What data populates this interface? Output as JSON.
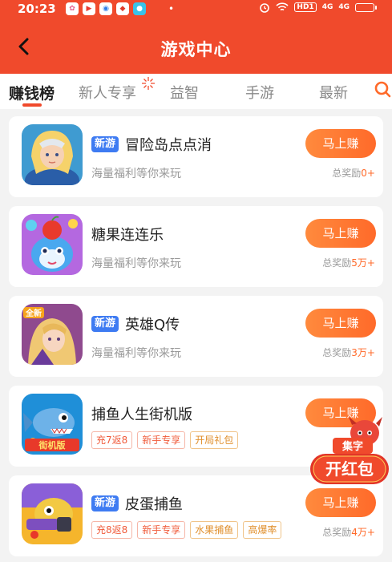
{
  "status_bar": {
    "time": "20:23",
    "hd_label": "HD1",
    "signal_labels": [
      "4G",
      "4G"
    ],
    "app_icons": [
      "gallery-app-icon",
      "video-app-icon",
      "browser-app-icon",
      "game-app-icon",
      "bag-app-icon"
    ],
    "app_glyphs": [
      "✿",
      "▶",
      "◉",
      "◆",
      "●"
    ],
    "bullet": "•"
  },
  "header": {
    "title": "游戏中心",
    "back_icon": "chevron-left-icon"
  },
  "tabs": [
    {
      "label": "赚钱榜",
      "active": true
    },
    {
      "label": "新人专享",
      "active": false
    },
    {
      "label": "益智",
      "active": false
    },
    {
      "label": "手游",
      "active": false
    },
    {
      "label": "最新",
      "active": false
    }
  ],
  "colors": {
    "brand": "#f04a2c",
    "button": "#ff6a2a",
    "new_tag": "#3e7bf2"
  },
  "games": [
    {
      "new_tag": "新游",
      "name": "冒险岛点点消",
      "desc": "海量福利等你来玩",
      "button": "马上赚",
      "reward_label": "总奖励",
      "reward_amount": "0+"
    },
    {
      "name": "糖果连连乐",
      "desc": "海量福利等你来玩",
      "button": "马上赚",
      "reward_label": "总奖励",
      "reward_amount": "5万+"
    },
    {
      "new_tag": "新游",
      "name": "英雄Q传",
      "desc": "海量福利等你来玩",
      "button": "马上赚",
      "reward_label": "总奖励",
      "reward_amount": "3万+"
    },
    {
      "name": "捕鱼人生街机版",
      "chips": [
        "充7返8",
        "新手专享",
        "开局礼包"
      ],
      "button": "马上赚"
    },
    {
      "new_tag": "新游",
      "name": "皮蛋捕鱼",
      "chips": [
        "充8返8",
        "新手专享",
        "水果捕鱼",
        "高爆率"
      ],
      "button": "马上赚",
      "reward_label": "总奖励",
      "reward_amount": "4万+"
    }
  ],
  "game_icon_logos": {
    "game_4": "街机版",
    "game_3": "全新"
  },
  "red_packet": {
    "top_label": "集字",
    "main_label": "开红包"
  }
}
